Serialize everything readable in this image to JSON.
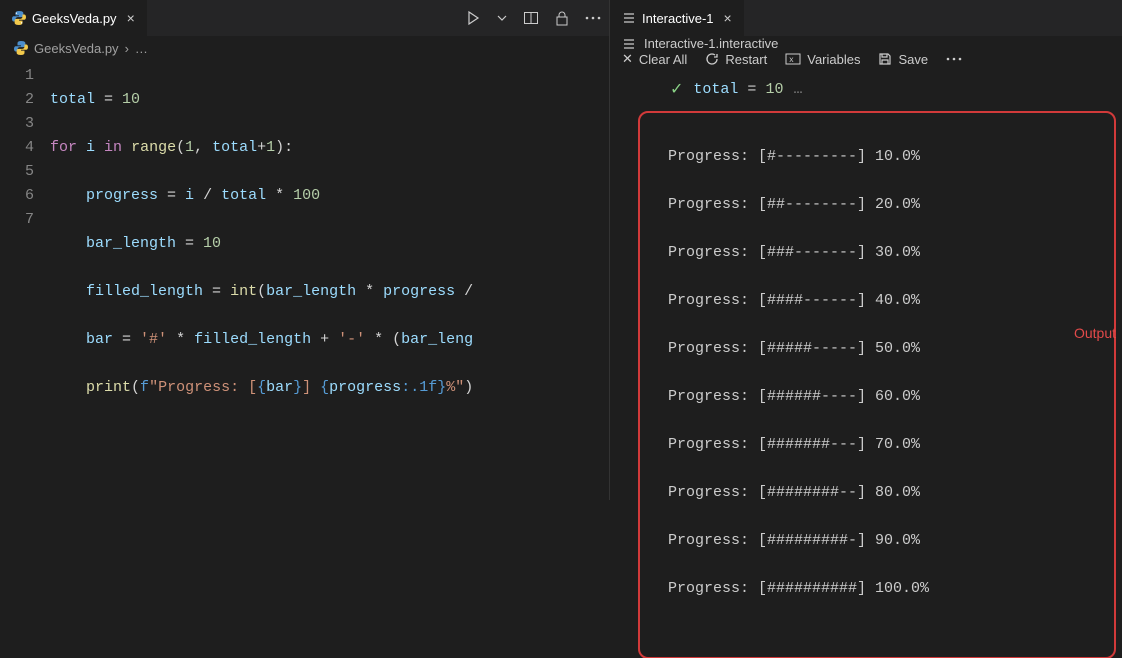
{
  "left": {
    "tab": {
      "filename": "GeeksVeda.py"
    },
    "breadcrumb": {
      "filename": "GeeksVeda.py",
      "chevron": "›",
      "dots": "…"
    },
    "gutter": [
      "1",
      "2",
      "3",
      "4",
      "5",
      "6",
      "7"
    ],
    "code": {
      "l1": {
        "var": "total",
        "eq": " = ",
        "num": "10"
      },
      "l2": {
        "for": "for ",
        "i": "i",
        "sp": " ",
        "in": "in ",
        "range": "range",
        "lp": "(",
        "a": "1",
        "c": ", ",
        "t": "total",
        "pl": "+",
        "b": "1",
        "rp": "):"
      },
      "l3": {
        "var": "progress",
        "eq": " = ",
        "i": "i",
        "sp": " / ",
        "t": "total",
        "sp2": " * ",
        "n": "100"
      },
      "l4": {
        "var": "bar_length",
        "eq": " = ",
        "n": "10"
      },
      "l5": {
        "var": "filled_length",
        "eq": " = ",
        "fn": "int",
        "lp": "(",
        "a": "bar_length",
        "sp": " * ",
        "b": "progress ",
        "end": "/"
      },
      "l6": {
        "var": "bar",
        "eq": " = ",
        "s1": "'#'",
        "sp": " * ",
        "a": "filled_length",
        "pl": " + ",
        "s2": "'-'",
        "sp2": " * (",
        "b": "bar_leng"
      },
      "l7": {
        "fn": "print",
        "lp": "(",
        "f": "f",
        "s": "\"Progress: [",
        "b1": "{",
        "v1": "bar",
        "b2": "}",
        "mid": "] ",
        "b3": "{",
        "v2": "progress",
        "fmt": ":.1f",
        "b4": "}",
        "end": "%\"",
        "rp": ")"
      }
    }
  },
  "right": {
    "tab": {
      "name": "Interactive-1"
    },
    "sectionTitle": "Interactive-1.interactive",
    "toolbar": {
      "clear": "Clear All",
      "restart": "Restart",
      "variables": "Variables",
      "save": "Save"
    },
    "cell": {
      "code": "total = 10",
      "dots": "…"
    },
    "outputDots": "…",
    "outputLabel": "Output",
    "output": [
      "Progress: [#---------] 10.0%",
      "Progress: [##--------] 20.0%",
      "Progress: [###-------] 30.0%",
      "Progress: [####------] 40.0%",
      "Progress: [#####-----] 50.0%",
      "Progress: [######----] 60.0%",
      "Progress: [#######---] 70.0%",
      "Progress: [########--] 80.0%",
      "Progress: [#########-] 90.0%",
      "Progress: [##########] 100.0%"
    ]
  }
}
